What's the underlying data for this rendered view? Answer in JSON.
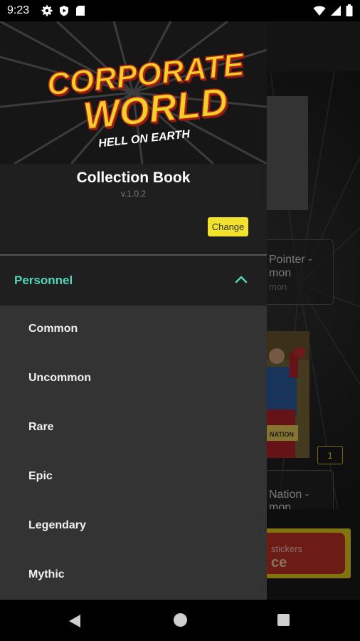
{
  "status_bar": {
    "time": "9:23",
    "icons_left": [
      "gear-icon",
      "play-protect-icon",
      "sd-card-icon"
    ],
    "icons_right": [
      "wifi-icon",
      "signal-icon",
      "battery-icon"
    ]
  },
  "background": {
    "cards": [
      {
        "title": "Pointer -",
        "title2": "mon",
        "subtitle": "mon"
      },
      {
        "title": "Nation -",
        "title2": "mon"
      }
    ],
    "count_badge": "1",
    "open_button": {
      "line1": "stickers",
      "line2": "ce"
    }
  },
  "drawer": {
    "logo": {
      "line1": "CORPORATE",
      "line2": "WORLD",
      "tagline": "HELL ON EARTH"
    },
    "title": "Collection Book",
    "version": "v.1.0.2",
    "change_label": "Change",
    "section": {
      "label": "Personnel",
      "expanded": true,
      "items": [
        "Common",
        "Uncommon",
        "Rare",
        "Epic",
        "Legendary",
        "Mythic"
      ]
    }
  },
  "colors": {
    "accent_teal": "#56d6b6",
    "accent_yellow": "#f3e22c",
    "drawer_bg": "#1f1f1f",
    "submenu_bg": "#333333"
  },
  "nav_bar": {
    "icons": [
      "back-icon",
      "home-icon",
      "recents-icon"
    ]
  }
}
